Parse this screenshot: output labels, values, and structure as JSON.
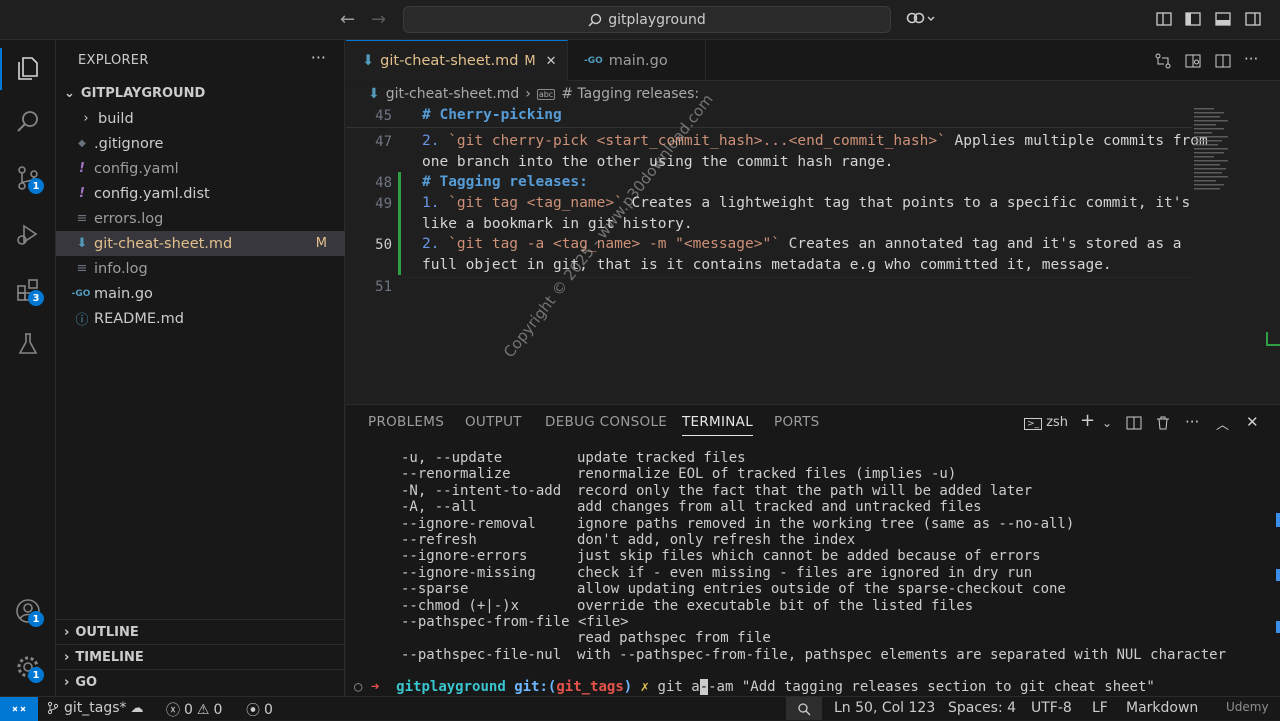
{
  "titlebar": {
    "search": "gitplayground",
    "back": "←",
    "forward": "→"
  },
  "activity": {
    "scm_badge": "1",
    "extensions_badge": "3",
    "accounts_badge": "1",
    "manage_badge": "1"
  },
  "explorer": {
    "header": "EXPLORER",
    "folder": "GITPLAYGROUND",
    "items": [
      {
        "icon": "›",
        "label": "build"
      },
      {
        "icon": "◆",
        "label": ".gitignore"
      },
      {
        "icon": "!",
        "label": "config.yaml"
      },
      {
        "icon": "!",
        "label": "config.yaml.dist"
      },
      {
        "icon": "≡",
        "label": "errors.log"
      },
      {
        "icon": "⬇",
        "label": "git-cheat-sheet.md",
        "badge": "M"
      },
      {
        "icon": "≡",
        "label": "info.log"
      },
      {
        "icon": "-GO",
        "label": "main.go"
      },
      {
        "icon": "ⓘ",
        "label": "README.md"
      }
    ],
    "sections": [
      "OUTLINE",
      "TIMELINE",
      "GO"
    ]
  },
  "tabs": [
    {
      "label": "git-cheat-sheet.md",
      "badge": "M",
      "close": "✕"
    },
    {
      "label": "main.go"
    }
  ],
  "breadcrumb": {
    "file": "git-cheat-sheet.md",
    "sep": "›",
    "symbol": "# Tagging releases:"
  },
  "editor": {
    "lines": [
      {
        "n": "45",
        "text": "# Cherry-picking"
      },
      {
        "n": "47",
        "num": "2.",
        "code": "`git cherry-pick <start_commit_hash>...<end_commit_hash>`",
        "rest": " Applies multiple commits from",
        "cont": "one branch into the other using the commit hash range."
      },
      {
        "n": "48",
        "text": "# Tagging releases:"
      },
      {
        "n": "49",
        "num": "1.",
        "code": "`git tag <tag_name>`",
        "rest": " Creates a lightweight tag that points to a specific commit, it's",
        "cont": "like a bookmark in git history."
      },
      {
        "n": "50",
        "num": "2.",
        "code": "`git tag -a <tag_name> -m \"<message>\"`",
        "rest": " Creates an annotated tag and it's stored as a",
        "cont": "full object in git, that is it contains metadata e.g who committed it, message."
      },
      {
        "n": "51"
      }
    ]
  },
  "panel": {
    "tabs": [
      "PROBLEMS",
      "OUTPUT",
      "DEBUG CONSOLE",
      "TERMINAL",
      "PORTS"
    ],
    "shell": "zsh",
    "terminal_lines": [
      [
        "-u, --update",
        "update tracked files"
      ],
      [
        "--renormalize",
        "renormalize EOL of tracked files (implies -u)"
      ],
      [
        "-N, --intent-to-add",
        "record only the fact that the path will be added later"
      ],
      [
        "-A, --all",
        "add changes from all tracked and untracked files"
      ],
      [
        "--ignore-removal",
        "ignore paths removed in the working tree (same as --no-all)"
      ],
      [
        "--refresh",
        "don't add, only refresh the index"
      ],
      [
        "--ignore-errors",
        "just skip files which cannot be added because of errors"
      ],
      [
        "--ignore-missing",
        "check if - even missing - files are ignored in dry run"
      ],
      [
        "--sparse",
        "allow updating entries outside of the sparse-checkout cone"
      ],
      [
        "--chmod (+|-)x",
        "override the executable bit of the listed files"
      ],
      [
        "--pathspec-from-file <file>",
        ""
      ],
      [
        "",
        "read pathspec from file"
      ],
      [
        "--pathspec-file-nul",
        "with --pathspec-from-file, pathspec elements are separated with NUL character"
      ]
    ],
    "prompt": {
      "dir": "gitplayground",
      "git": "git:(",
      "branch": "git_tags",
      "close": ")",
      "mark": "✗",
      "cmd_pre": "git a",
      "cmd_post": "-am \"Add tagging releases section to git cheat sheet\""
    }
  },
  "status": {
    "branch": "git_tags*",
    "errors": "0",
    "warnings": "0",
    "ports": "0",
    "position": "Ln 50, Col 123",
    "spaces": "Spaces: 4",
    "encoding": "UTF-8",
    "eol": "LF",
    "language": "Markdown"
  },
  "watermark": "Copyright © 2025 - www.p30download.com",
  "corner_logo": "Udemy"
}
